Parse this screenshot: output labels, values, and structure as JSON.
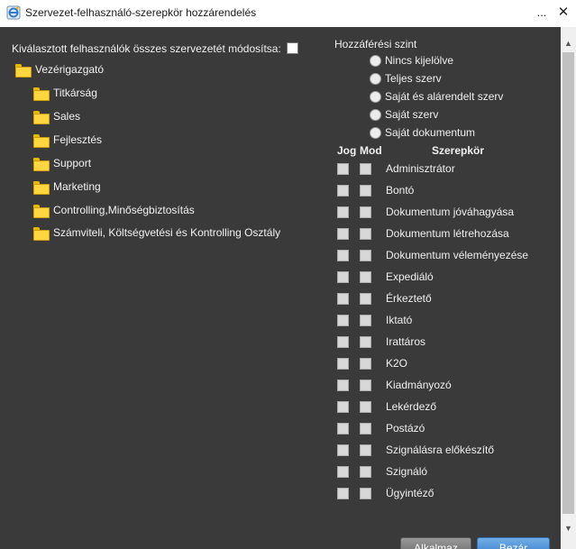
{
  "window": {
    "title": "Szervezet-felhasználó-szerepkör hozzárendelés",
    "menu_glyph": "...",
    "close_glyph": "✕"
  },
  "modify_all": {
    "label": "Kiválasztott felhasználók összes szervezetét módosítsa:",
    "checked": false
  },
  "tree": {
    "root": "Vezérigazgató",
    "children": [
      "Titkárság",
      "Sales",
      "Fejlesztés",
      "Support",
      "Marketing",
      "Controlling,Minőségbiztosítás",
      "Számviteli, Költségvetési és Kontrolling Osztály"
    ]
  },
  "access": {
    "title": "Hozzáférési szint",
    "options": [
      "Nincs kijelölve",
      "Teljes szerv",
      "Saját és alárendelt szerv",
      "Saját szerv",
      "Saját dokumentum"
    ]
  },
  "roles": {
    "headers": {
      "jog": "Jog",
      "mod": "Mod",
      "role": "Szerepkör"
    },
    "items": [
      "Adminisztrátor",
      "Bontó",
      "Dokumentum jóváhagyása",
      "Dokumentum létrehozása",
      "Dokumentum véleményezése",
      "Expediáló",
      "Érkeztető",
      "Iktató",
      "Irattáros",
      "K2O",
      "Kiadmányozó",
      "Lekérdező",
      "Postázó",
      "Szignálásra előkészítő",
      "Szignáló",
      "Ügyintéző"
    ]
  },
  "buttons": {
    "apply": "Alkalmaz",
    "close": "Bezár"
  },
  "scrollbar": {
    "up_glyph": "▲",
    "down_glyph": "▼"
  },
  "colors": {
    "panel_bg": "#3a3a3a",
    "folder": "#ffd640",
    "close_button": "#3b82cf"
  }
}
